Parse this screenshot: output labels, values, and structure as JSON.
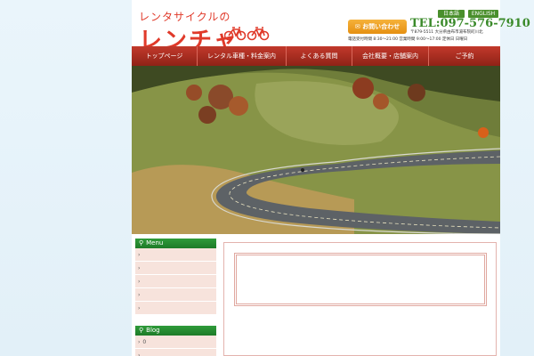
{
  "header": {
    "logo_top": "レンタサイクルの",
    "logo_main": "レンチャ",
    "lang_ja": "日本語",
    "lang_en": "ENGLISH",
    "contact_button": "お問い合わせ",
    "tel": "TEL:097-576-7910",
    "address": "〒879-5511 大分県由布市湯布院町川北",
    "hours": "電話受付時間 8:30〜21:00 営業時間 9:00〜17:00 定休日 日曜日"
  },
  "nav": {
    "items": [
      "トップページ",
      "レンタル車種・料金案内",
      "よくある質問",
      "会社概要・店舗案内",
      "ご予約"
    ]
  },
  "sidebar": {
    "menu_title": "Menu",
    "menu_items": [
      "",
      "",
      "",
      "",
      ""
    ],
    "blog_title": "Blog",
    "blog_items": [
      "0",
      ""
    ]
  },
  "colors": {
    "brand_red": "#e03a2a",
    "nav_red": "#a52a1e",
    "accent_green": "#2f9b3a",
    "tel_green": "#3a8a2a",
    "side_bg": "#f7e3dc",
    "contact_orange": "#f0a22a"
  },
  "icons": {
    "bike_logo": "bicycle-icon",
    "side_head": "bicycle-icon",
    "contact": "mail-icon"
  }
}
